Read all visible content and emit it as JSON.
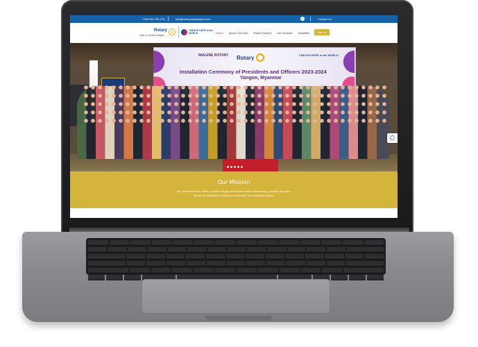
{
  "topbar": {
    "phone": "+959 964 766 279",
    "email": "info@rotaryclubyangon.com",
    "facebook_icon": "f",
    "contact": "Contact Us"
  },
  "logo": {
    "rotary": "Rotary",
    "club": "Club of Central Yangon",
    "create_hope": "CREATE HOPE in the WORLD"
  },
  "nav": {
    "items": [
      "Home",
      "About Our Club",
      "What's Rotary?",
      "Get Involved",
      "Activities"
    ],
    "join": "Join Us"
  },
  "hero": {
    "backdrop_imagine": "IMAGINE ROTARY",
    "backdrop_rotary": "Rotary",
    "backdrop_create_hope": "CREATE HOPE in the WORLD",
    "backdrop_title": "Installation Ceremony of Presidents and Officers 2023-2024",
    "backdrop_subtitle": "Yangon, Myanmar",
    "slides_total": 5,
    "slide_active": 1
  },
  "mission": {
    "title": "Our Mission",
    "line1": "We provide service to others, promote integrity, and advance world understanding, goodwill, and peace",
    "line2": "through our fellowship of business, professional, and community leaders."
  },
  "colors": {
    "topbar": "#1761a8",
    "accent_gold": "#d4b43a",
    "nav_active": "#d6213b"
  }
}
